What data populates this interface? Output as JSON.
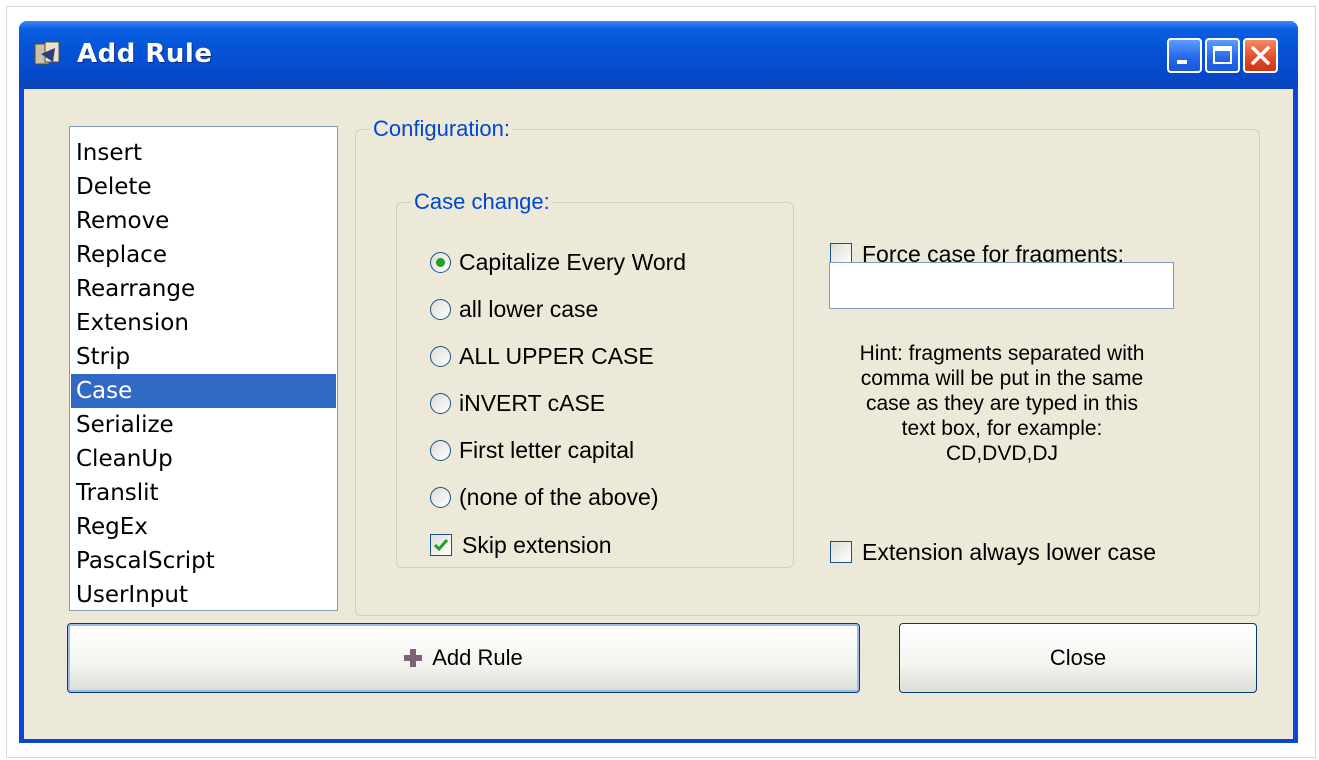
{
  "window": {
    "title": "Add Rule"
  },
  "rules_list": {
    "items": [
      "Insert",
      "Delete",
      "Remove",
      "Replace",
      "Rearrange",
      "Extension",
      "Strip",
      "Case",
      "Serialize",
      "CleanUp",
      "Translit",
      "RegEx",
      "PascalScript",
      "UserInput"
    ],
    "selected": "Case"
  },
  "configuration": {
    "legend": "Configuration:",
    "case_change": {
      "legend": "Case change:",
      "options": [
        "Capitalize Every Word",
        "all lower case",
        "ALL UPPER CASE",
        "iNVERT cASE",
        "First letter capital",
        "(none of the above)"
      ],
      "selected": "Capitalize Every Word"
    },
    "skip_extension": {
      "label": "Skip extension",
      "checked": true
    },
    "force_case": {
      "label": "Force case for fragments:",
      "checked": false,
      "value": ""
    },
    "hint": [
      "Hint: fragments separated with",
      "comma will be put in the same",
      "case as they are typed in this",
      "text box, for example:",
      "CD,DVD,DJ"
    ],
    "extension_lower": {
      "label": "Extension always lower case",
      "checked": false
    }
  },
  "buttons": {
    "add_rule": "Add Rule",
    "close": "Close"
  },
  "colors": {
    "accent": "#0046d5",
    "selection": "#316ac5",
    "titlebar": "#0654d8"
  }
}
